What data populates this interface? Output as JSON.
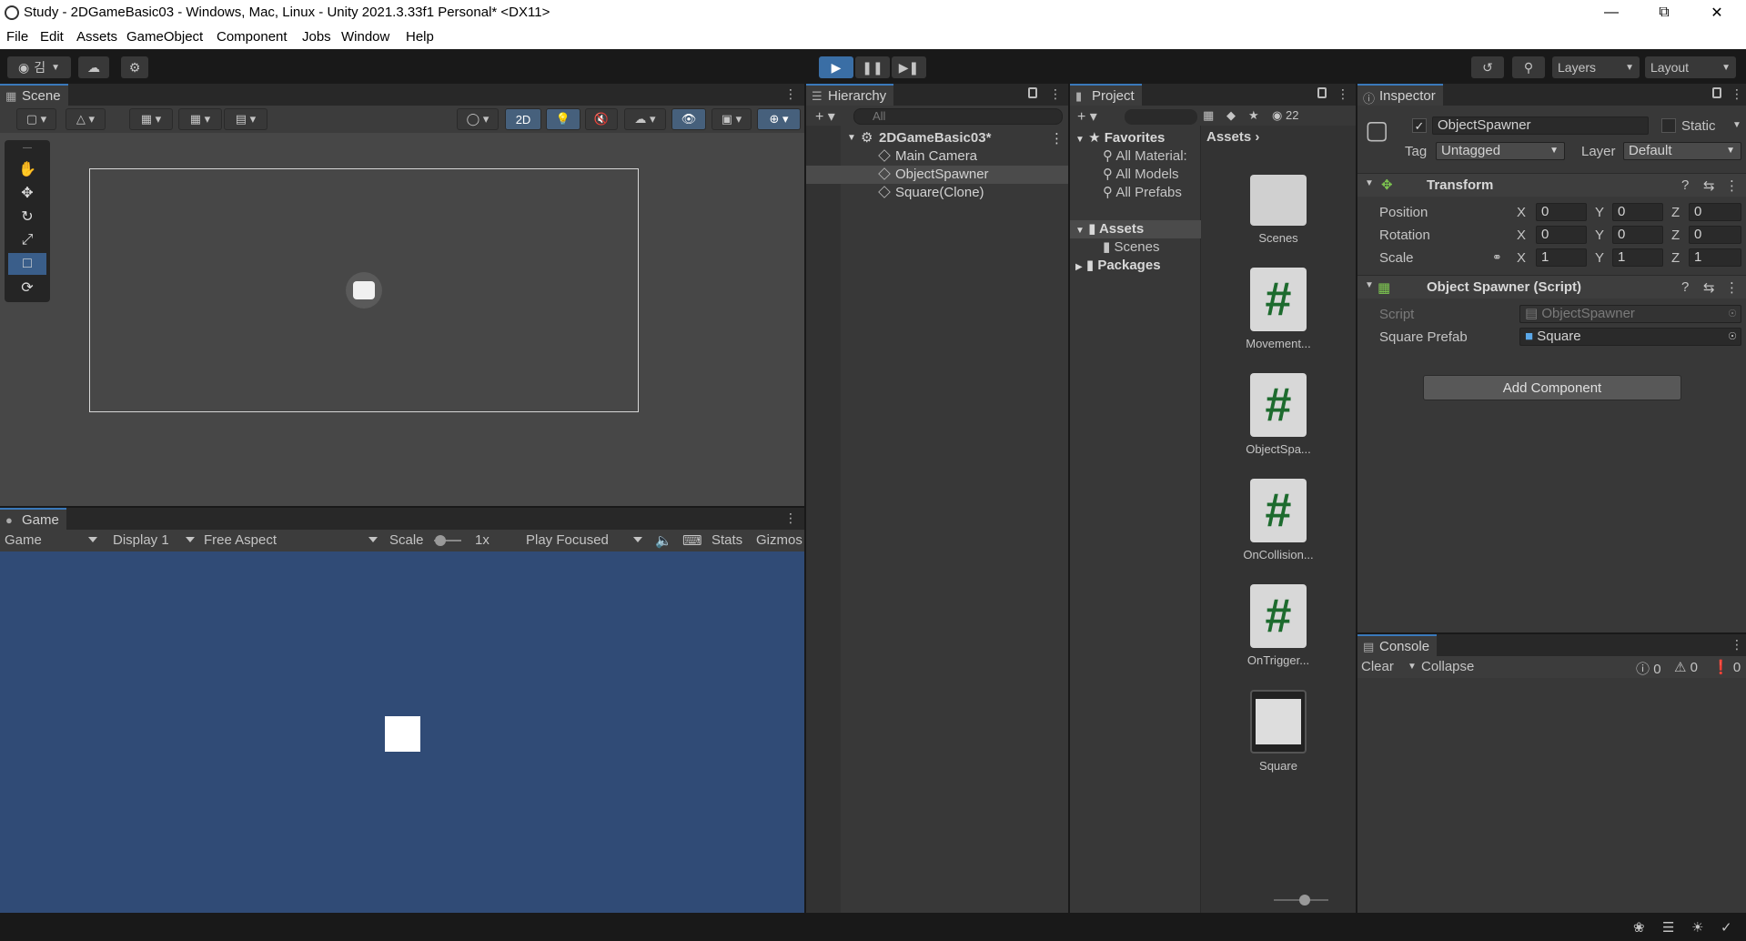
{
  "window": {
    "title": "Study - 2DGameBasic03 - Windows, Mac, Linux - Unity 2021.3.33f1 Personal* <DX11>"
  },
  "menu": [
    "File",
    "Edit",
    "Assets",
    "GameObject",
    "Component",
    "Jobs",
    "Window",
    "Help"
  ],
  "toolbar": {
    "account": "김",
    "layers": "Layers",
    "layout": "Layout"
  },
  "scene": {
    "tab": "Scene",
    "mode2d": "2D"
  },
  "game": {
    "tab": "Game",
    "view": "Game",
    "display": "Display 1",
    "aspect": "Free Aspect",
    "scale_label": "Scale",
    "scale_value": "1x",
    "play_mode": "Play Focused",
    "stats": "Stats",
    "gizmos": "Gizmos"
  },
  "hierarchy": {
    "tab": "Hierarchy",
    "search_placeholder": "All",
    "scene": "2DGameBasic03*",
    "items": [
      "Main Camera",
      "ObjectSpawner",
      "Square(Clone)"
    ]
  },
  "project": {
    "tab": "Project",
    "hidden_count": "22",
    "breadcrumb": "Assets",
    "favorites": {
      "label": "Favorites",
      "items": [
        "All Material:",
        "All Models",
        "All Prefabs"
      ]
    },
    "assets_root": "Assets",
    "assets_children": [
      "Scenes"
    ],
    "packages": "Packages",
    "assets": [
      {
        "name": "Scenes",
        "kind": "folder"
      },
      {
        "name": "Movement...",
        "kind": "script",
        "glyph": "#"
      },
      {
        "name": "ObjectSpa...",
        "kind": "script",
        "glyph": "#"
      },
      {
        "name": "OnCollision...",
        "kind": "script",
        "glyph": "#"
      },
      {
        "name": "OnTrigger...",
        "kind": "script",
        "glyph": "#"
      },
      {
        "name": "Square",
        "kind": "sprite"
      }
    ]
  },
  "inspector": {
    "tab": "Inspector",
    "object_name": "ObjectSpawner",
    "static": "Static",
    "tag_label": "Tag",
    "tag": "Untagged",
    "layer_label": "Layer",
    "layer": "Default",
    "transform": {
      "title": "Transform",
      "position": {
        "label": "Position",
        "x": "0",
        "y": "0",
        "z": "0"
      },
      "rotation": {
        "label": "Rotation",
        "x": "0",
        "y": "0",
        "z": "0"
      },
      "scale": {
        "label": "Scale",
        "x": "1",
        "y": "1",
        "z": "1"
      }
    },
    "script_component": {
      "title": "Object Spawner (Script)",
      "script_label": "Script",
      "script": "ObjectSpawner",
      "prefab_label": "Square Prefab",
      "prefab": "Square"
    },
    "add_component": "Add Component",
    "axis": {
      "x": "X",
      "y": "Y",
      "z": "Z"
    }
  },
  "console": {
    "tab": "Console",
    "clear": "Clear",
    "collapse": "Collapse",
    "logs": "0",
    "warnings": "0",
    "errors": "0"
  },
  "colors": {
    "accent": "#3a79bb",
    "game_bg": "#304b76",
    "script_icon": "#1d6b2e"
  }
}
